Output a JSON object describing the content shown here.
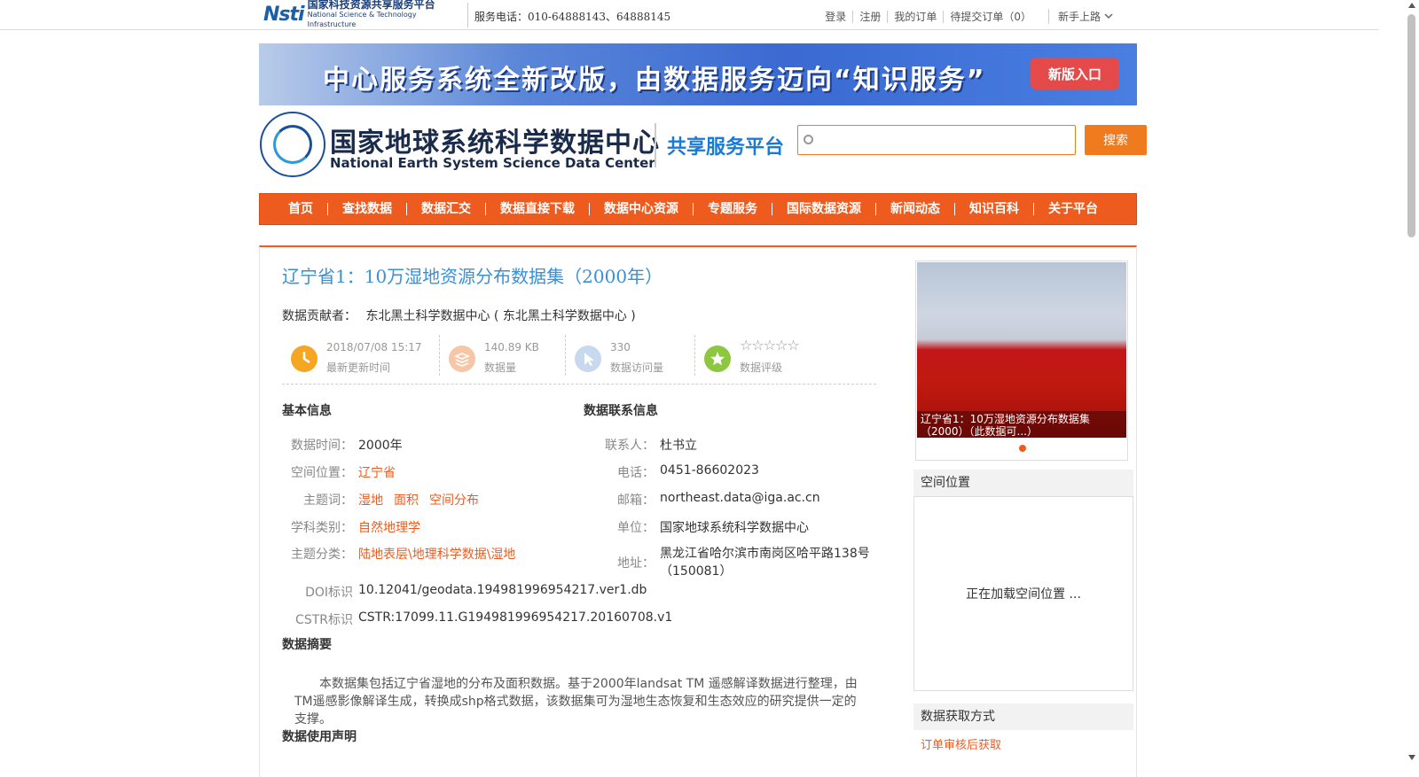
{
  "topbar": {
    "logo_mark": "Nsti",
    "logo_cn": "国家科技资源共享服务平台",
    "logo_en": "National Science & Technology Infrastructure",
    "phone": "服务电话：010-64888143、64888145",
    "links": [
      "登录",
      "注册",
      "我的订单",
      "待提交订单（0）"
    ],
    "guide": "新手上路"
  },
  "banner": {
    "text": "中心服务系统全新改版，由数据服务迈向“知识服务”",
    "button": "新版入口"
  },
  "header": {
    "site_cn": "国家地球系统科学数据中心",
    "site_en": "National Earth System Science Data Center",
    "platform": "共享服务平台",
    "search_placeholder": "",
    "search_button": "搜索"
  },
  "nav": [
    "首页",
    "查找数据",
    "数据汇交",
    "数据直接下载",
    "数据中心资源",
    "专题服务",
    "国际数据资源",
    "新闻动态",
    "知识百科",
    "关于平台"
  ],
  "dataset": {
    "title": "辽宁省1：10万湿地资源分布数据集（2000年）",
    "contributor_label": "数据贡献者：",
    "contributor": "东北黑土科学数据中心 ( 东北黑土科学数据中心 )",
    "stats": [
      {
        "value": "2018/07/08 15:17",
        "label": "最新更新时间",
        "color": "#f5a623"
      },
      {
        "value": "140.89 KB",
        "label": "数据量",
        "color": "#f7c6a6"
      },
      {
        "value": "330",
        "label": "数据访问量",
        "color": "#c8d8ee"
      },
      {
        "value": "☆☆☆☆☆",
        "label": "数据评级",
        "color": "#8dc63f"
      }
    ]
  },
  "basic": {
    "heading": "基本信息",
    "time_label": "数据时间：",
    "time": "2000年",
    "location_label": "空间位置：",
    "location": "辽宁省",
    "keywords_label": "主题词：",
    "keywords": [
      "湿地",
      "面积",
      "空间分布"
    ],
    "discipline_label": "学科类别：",
    "discipline": "自然地理学",
    "category_label": "主题分类：",
    "category": "陆地表层\\地理科学数据\\湿地",
    "doi_label": "DOI标识",
    "doi": "10.12041/geodata.194981996954217.ver1.db",
    "cstr_label": "CSTR标识",
    "cstr": "CSTR:17099.11.G194981996954217.20160708.v1"
  },
  "contact": {
    "heading": "数据联系信息",
    "person_label": "联系人：",
    "person": "杜书立",
    "phone_label": "电话：",
    "phone": "0451-86602023",
    "email_label": "邮箱：",
    "email": "northeast.data@iga.ac.cn",
    "org_label": "单位：",
    "org": "国家地球系统科学数据中心",
    "addr_label": "地址：",
    "addr": "黑龙江省哈尔滨市南岗区哈平路138号（150081）"
  },
  "abstract": {
    "heading": "数据摘要",
    "text": "本数据集包括辽宁省湿地的分布及面积数据。基于2000年landsat TM 遥感解译数据进行整理，由TM遥感影像解译生成，转换成shp格式数据，该数据集可为湿地生态恢复和生态效应的研究提供一定的支撑。"
  },
  "usage": {
    "heading": "数据使用声明"
  },
  "side": {
    "photo_caption": "辽宁省1：10万湿地资源分布数据集（2000）（此数据可...）",
    "spatial_heading": "空间位置",
    "map_loading": "正在加载空间位置 ...",
    "access_heading": "数据获取方式",
    "access": "订单审核后获取"
  },
  "colors": {
    "accent": "#ee5b1e",
    "title": "#3a8fd6",
    "banner_btn": "#e54a4a"
  }
}
